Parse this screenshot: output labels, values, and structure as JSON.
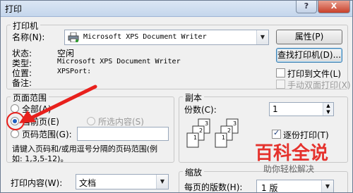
{
  "window": {
    "title": "打印"
  },
  "titlebar": {
    "help_label": "?",
    "close_label": "X"
  },
  "printer_group": {
    "label": "打印机",
    "name_label": "名称(N):",
    "name_value": "Microsoft XPS Document Writer",
    "status_label": "状态:",
    "status_value": "空闲",
    "type_label": "类型:",
    "type_value": "Microsoft XPS Document Writer",
    "where_label": "位置:",
    "where_value": "XPSPort:",
    "comment_label": "备注:",
    "properties_button": "属性(P)",
    "find_button": "查找打印机(D)...",
    "print_to_file": "打印到文件(L)",
    "manual_duplex": "手动双面打印(X)"
  },
  "page_range_group": {
    "label": "页面范围",
    "all": "全部(A)",
    "current": "当前页(E)",
    "selection": "所选内容(S)",
    "pages": "页码范围(G):",
    "hint_line1": "请键入页码和/或用逗号分隔的页码范围(例",
    "hint_line2": "如: 1,3,5-12)。"
  },
  "copies_group": {
    "label": "副本",
    "count_label": "份数(C):",
    "count_value": "1",
    "collate": "逐份打印(T)"
  },
  "print_what": {
    "label": "打印内容(W):",
    "value": "文档"
  },
  "zoom_group": {
    "label": "缩放",
    "pages_per_sheet_label": "每页的版数(H):",
    "pages_per_sheet_value": "1 版"
  },
  "watermark": {
    "line1": "百科全说",
    "line2": "助你轻松解决"
  },
  "colors": {
    "arrow": "#e8201c",
    "highlight_circle": "#e8201c",
    "watermark": "#e5322d"
  }
}
